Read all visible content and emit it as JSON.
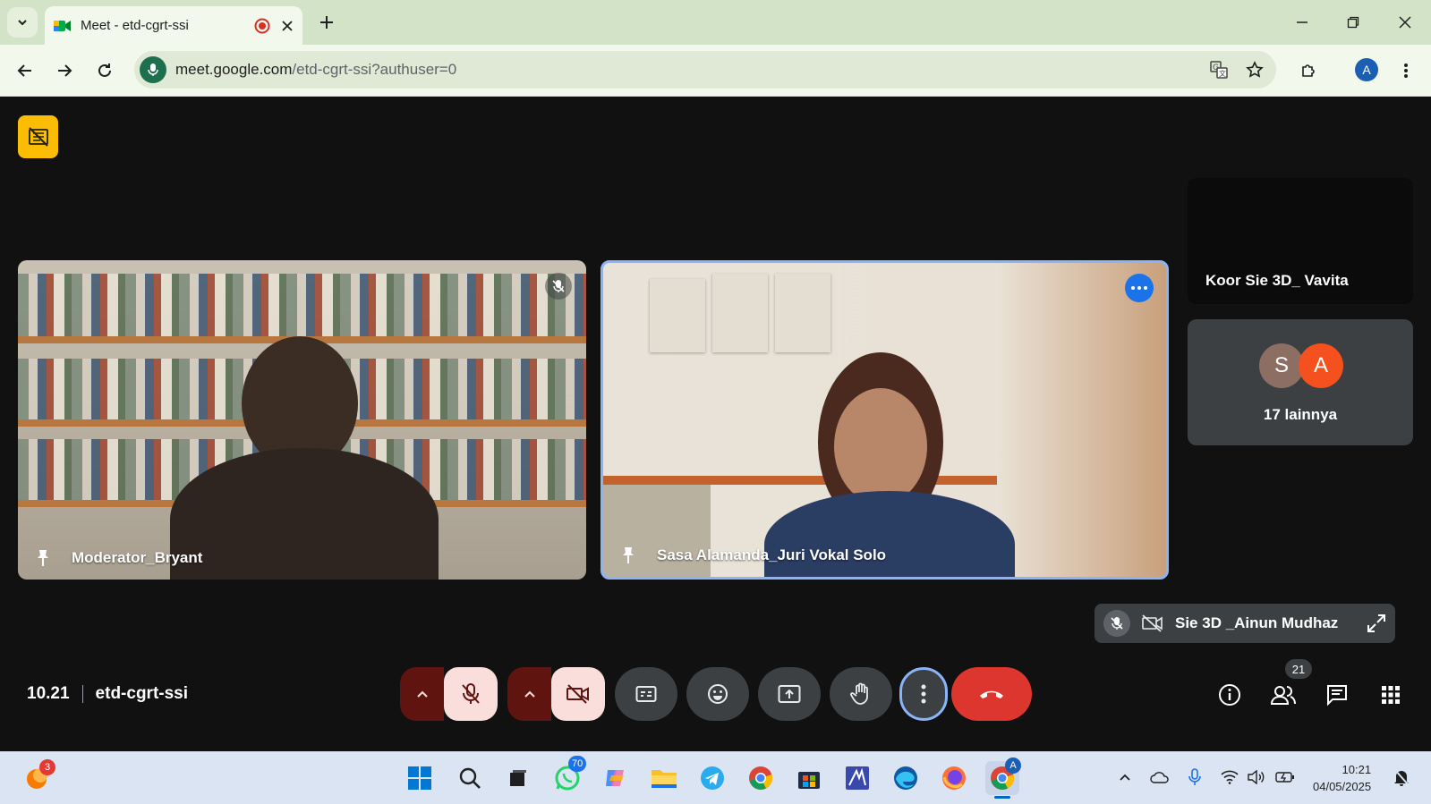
{
  "browser": {
    "tab_title": "Meet - etd-cgrt-ssi",
    "url_host": "meet.google.com",
    "url_path": "/etd-cgrt-ssi?authuser=0",
    "profile_initial": "A"
  },
  "meet": {
    "participants": [
      {
        "name": "Moderator_Bryant"
      },
      {
        "name": "Sasa Alamanda_Juri Vokal Solo"
      }
    ],
    "side_tile_name": "Koor Sie 3D_ Vavita",
    "others": {
      "avatars": [
        {
          "initial": "S",
          "color": "#8d6e63"
        },
        {
          "initial": "A",
          "color": "#f4511e"
        }
      ],
      "label": "17 lainnya"
    },
    "self_name": "Sie 3D _Ainun Mudhaz",
    "time": "10.21",
    "meeting_code": "etd-cgrt-ssi",
    "people_count": "21"
  },
  "taskbar": {
    "firefox_badge": "3",
    "whatsapp_badge": "70",
    "chrome_badge": "A",
    "time": "10:21",
    "date": "04/05/2025"
  },
  "colors": {
    "leave": "#dc362e",
    "muted_bg": "#f9dedc",
    "accent": "#8ab4f8",
    "record_badge": "#fbbc04"
  }
}
